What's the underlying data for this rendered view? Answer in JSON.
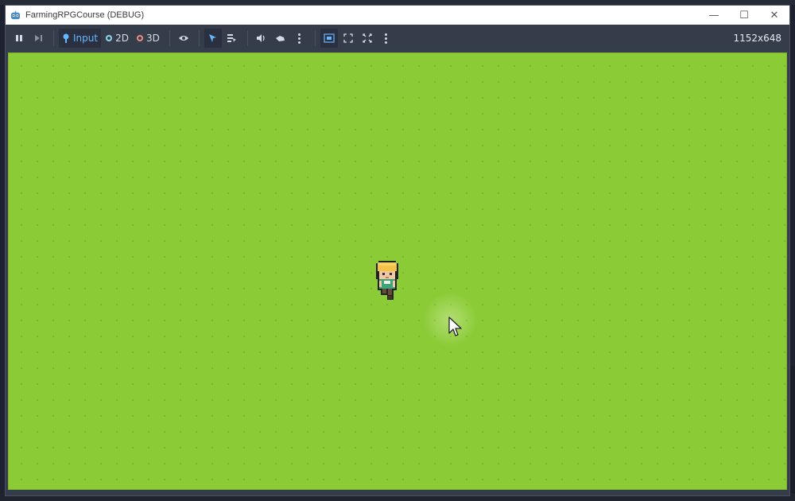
{
  "window": {
    "title": "FarmingRPGCourse (DEBUG)",
    "controls": {
      "minimize": "—",
      "maximize": "☐",
      "close": "✕"
    }
  },
  "toolbar": {
    "input_label": "Input",
    "mode_2d_label": "2D",
    "mode_3d_label": "3D",
    "resolution": "1152x648"
  },
  "game": {
    "background_color": "#8acb36",
    "player": "farmer-character",
    "cursor": "arrow-cursor"
  }
}
